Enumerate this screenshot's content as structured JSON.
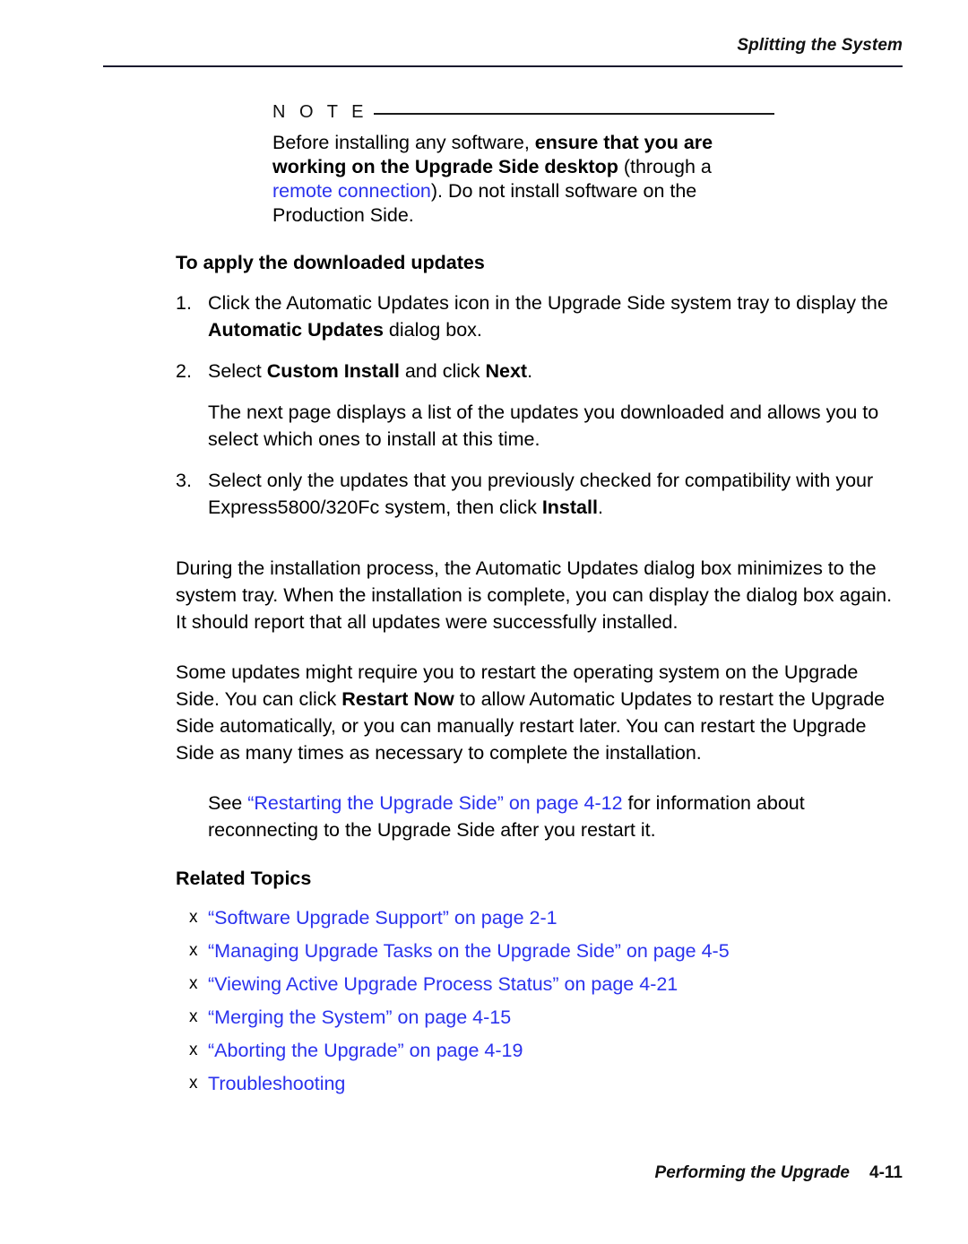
{
  "header": {
    "running_title": "Splitting the System"
  },
  "note": {
    "label": "N O T E",
    "text_before_bold": "Before installing any software, ",
    "bold_text": "ensure that you are working on the Upgrade Side desktop",
    "text_after_bold": " (through a ",
    "link_text": "remote connection",
    "text_tail": "). Do not install software on the Production Side."
  },
  "section": {
    "heading": "To apply the downloaded updates",
    "steps": [
      {
        "number": "1.",
        "text_parts": [
          {
            "text": "Click the Automatic Updates icon in the Upgrade Side system tray to display the ",
            "style": "normal"
          },
          {
            "text": "Automatic Updates",
            "style": "bold"
          },
          {
            "text": " dialog box.",
            "style": "normal"
          }
        ]
      },
      {
        "number": "2.",
        "text_parts": [
          {
            "text": "Select ",
            "style": "normal"
          },
          {
            "text": "Custom Install",
            "style": "bold"
          },
          {
            "text": " and click ",
            "style": "normal"
          },
          {
            "text": "Next",
            "style": "bold"
          },
          {
            "text": ".",
            "style": "normal"
          }
        ]
      },
      {
        "number": "3.",
        "text_parts": [
          {
            "text": "Select only the updates that you previously checked for compatibility with your Express5800/320Fc system, then click ",
            "style": "normal"
          },
          {
            "text": "Install",
            "style": "bold"
          },
          {
            "text": ".",
            "style": "normal"
          }
        ]
      }
    ],
    "step_note": "The next page displays a list of the updates you downloaded and allows you to select which ones to install at this time."
  },
  "paragraphs": {
    "during_install": "During the installation process, the Automatic Updates dialog box minimizes to the system tray. When the installation is complete, you can display the dialog box again. It should report that all updates were successfully installed.",
    "restart_before_bold": "Some updates might require you to restart the operating system on the Upgrade Side. You can click ",
    "restart_bold": "Restart Now",
    "restart_after_bold": " to allow Automatic Updates to restart the Upgrade Side automatically, or you can manually restart later. You can restart the Upgrade Side as many times as necessary to complete the installation.",
    "see_prefix": "See ",
    "see_link": "“Restarting the Upgrade Side” on page 4-12",
    "see_suffix": " for information about reconnecting to the Upgrade Side after you restart it."
  },
  "related_topics": {
    "heading": "Related Topics",
    "bullet_glyph": "x",
    "items": [
      {
        "label": "“Software Upgrade Support” on page 2-1"
      },
      {
        "label": "“Managing Upgrade Tasks on the Upgrade Side” on page 4-5"
      },
      {
        "label": "“Viewing Active Upgrade Process Status” on page 4-21"
      },
      {
        "label": "“Merging the System” on page 4-15"
      },
      {
        "label": "“Aborting the Upgrade” on page 4-19"
      },
      {
        "label": "Troubleshooting"
      }
    ]
  },
  "footer": {
    "title": "Performing the Upgrade",
    "page_number": "4-11"
  },
  "colors": {
    "link": "#2a32ee",
    "text": "#000000",
    "rule": "#1a1a2e"
  }
}
